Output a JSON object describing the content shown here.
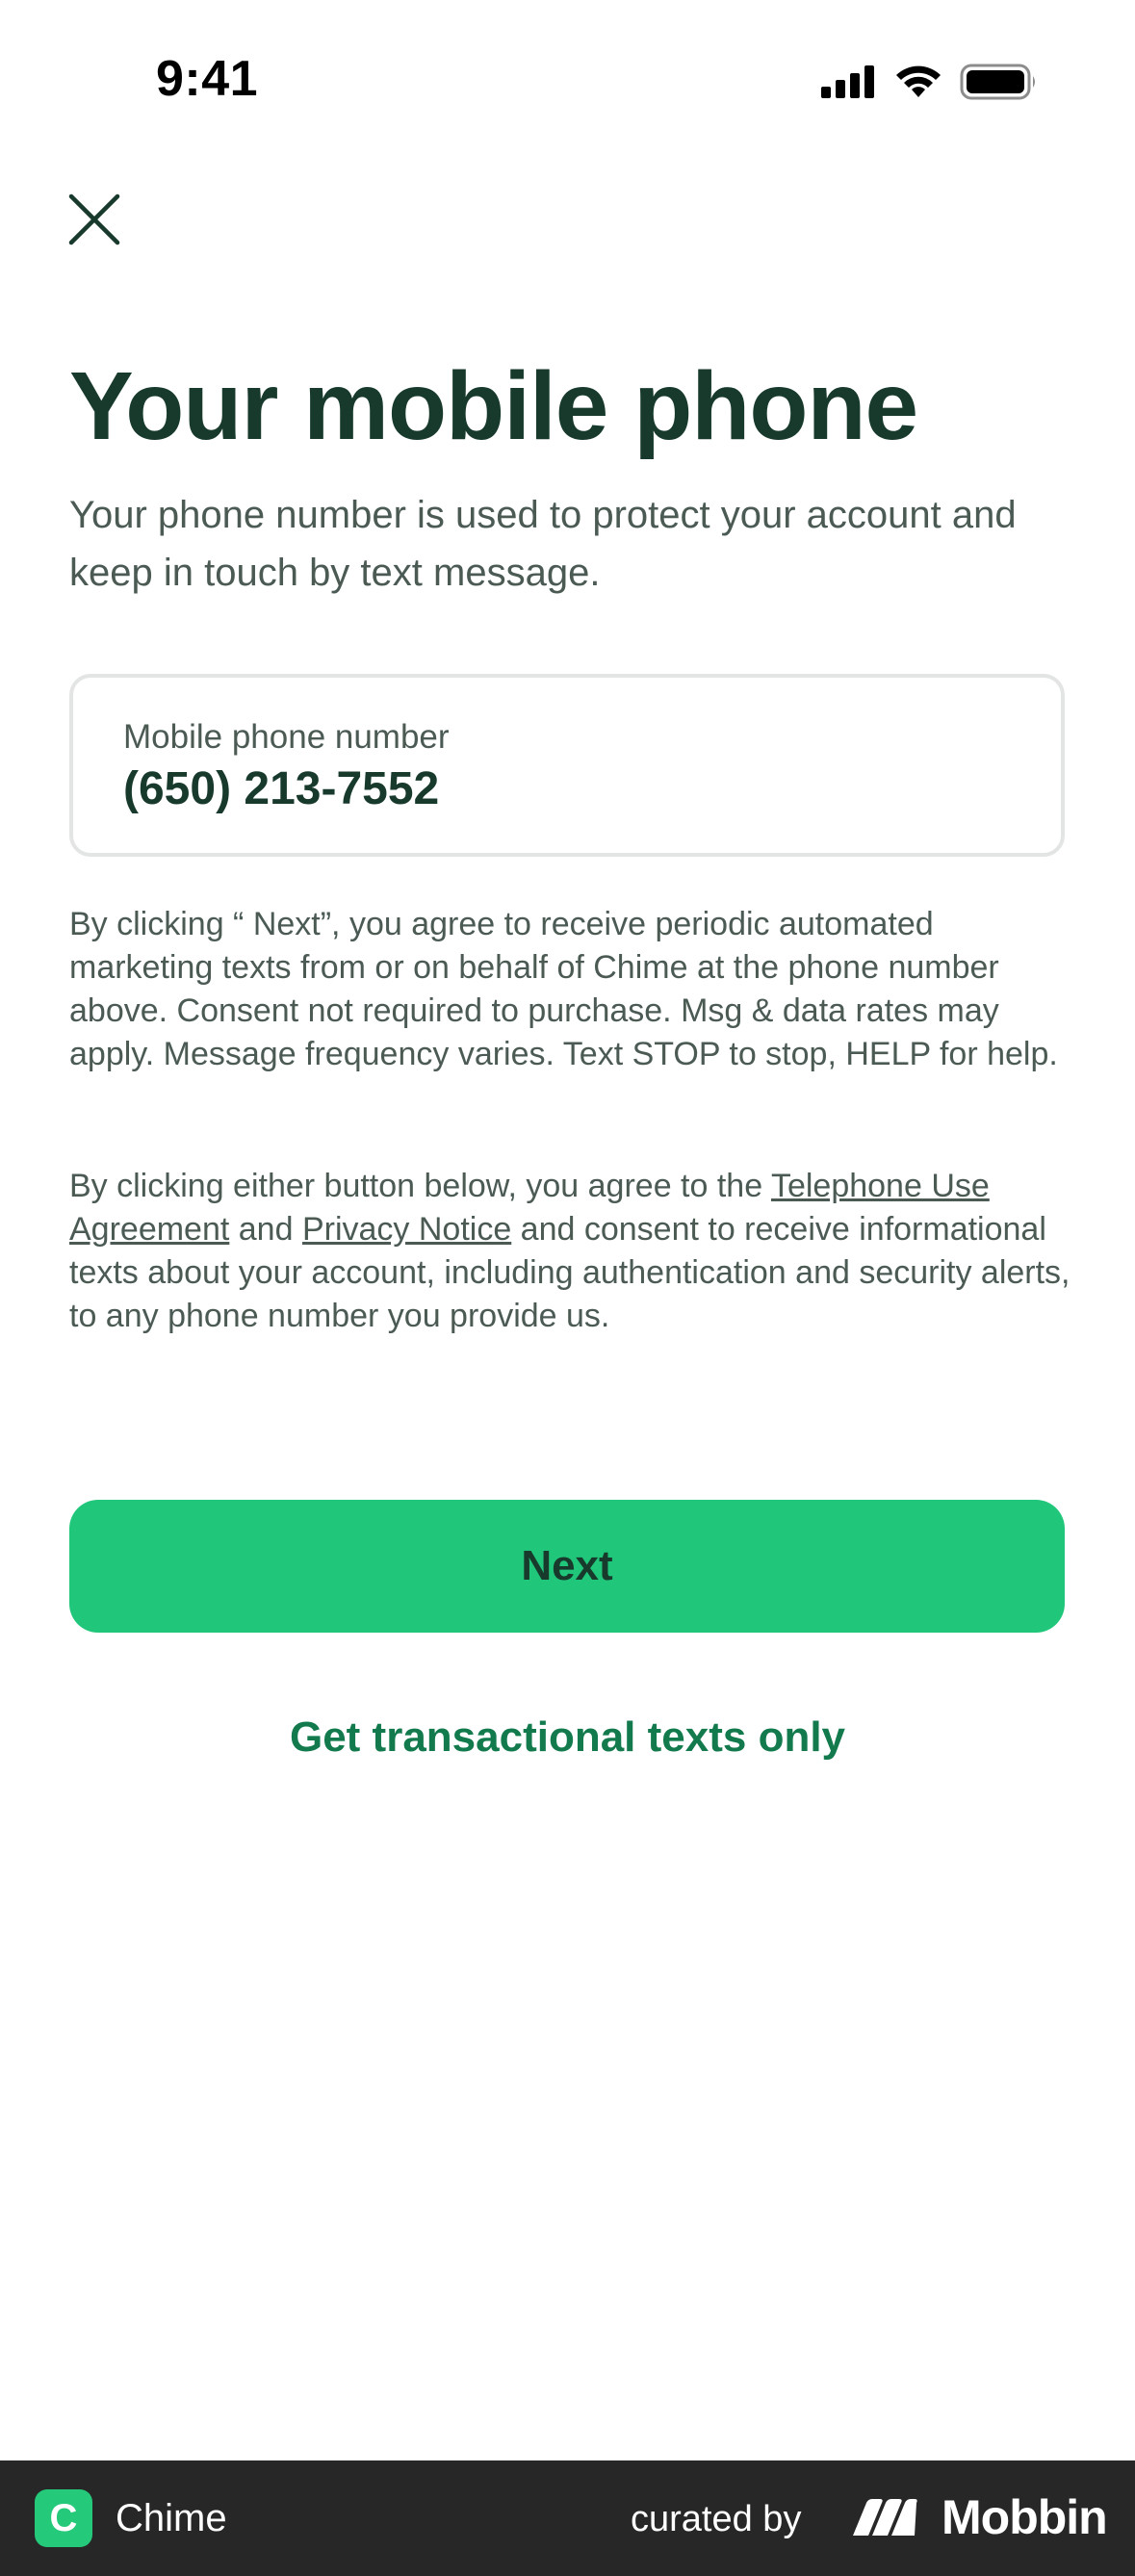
{
  "status_bar": {
    "time": "9:41",
    "icons": [
      "signal-icon",
      "wifi-icon",
      "battery-icon"
    ]
  },
  "header": {
    "close_icon": "close-icon"
  },
  "main": {
    "title": "Your mobile phone",
    "subtitle": "Your phone number is used to protect your account and keep in touch by text message.",
    "phone_field": {
      "label": "Mobile phone number",
      "value": "(650) 213-7552"
    },
    "disclaimer_marketing": "By clicking “ Next”, you agree to receive periodic automated marketing texts from or on behalf of Chime at the phone number above. Consent not required to purchase. Msg & data rates may apply. Message frequency varies. Text STOP to stop, HELP for help.",
    "disclaimer_terms": {
      "prefix": "By clicking either button below, you agree to the ",
      "link_telephone": "Telephone Use Agreement",
      "and": " and ",
      "link_privacy": "Privacy Notice",
      "suffix": " and consent to receive informational texts about your account, including authentication and security alerts, to any phone number you provide us."
    },
    "next_button": "Next",
    "secondary_link": "Get transactional texts only"
  },
  "footer": {
    "app_name": "Chime",
    "app_icon_letter": "C",
    "curated_by": "curated by",
    "brand": "Mobbin"
  },
  "colors": {
    "accent": "#20c67a",
    "title": "#173a2c",
    "link": "#127a4d",
    "body_text": "#4b5b54",
    "footer_bg": "#272727"
  }
}
